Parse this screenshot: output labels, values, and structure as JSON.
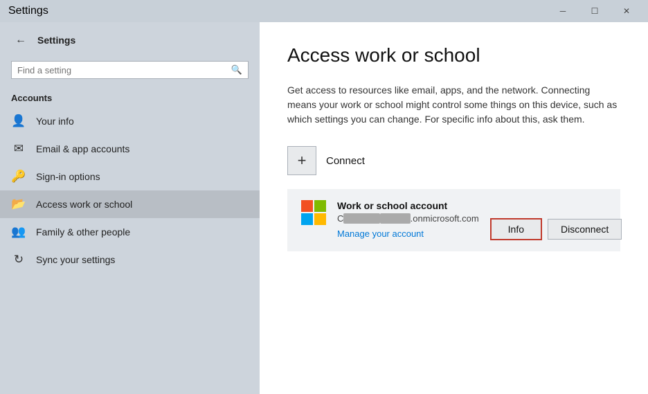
{
  "titlebar": {
    "title": "Settings",
    "min_label": "─",
    "max_label": "☐",
    "close_label": "✕"
  },
  "sidebar": {
    "back_icon": "←",
    "app_title": "Settings",
    "search": {
      "placeholder": "Find a setting",
      "icon": "⚲"
    },
    "section_label": "Accounts",
    "items": [
      {
        "label": "Your info",
        "icon": "👤",
        "active": false
      },
      {
        "label": "Email & app accounts",
        "icon": "✉",
        "active": false
      },
      {
        "label": "Sign-in options",
        "icon": "🔑",
        "active": false
      },
      {
        "label": "Access work or school",
        "icon": "🗂",
        "active": true
      },
      {
        "label": "Family & other people",
        "icon": "👥",
        "active": false
      },
      {
        "label": "Sync your settings",
        "icon": "🔄",
        "active": false
      }
    ]
  },
  "content": {
    "page_title": "Access work or school",
    "description": "Get access to resources like email, apps, and the network. Connecting means your work or school might control some things on this device, such as which settings you can change. For specific info about this, ask them.",
    "connect_label": "Connect",
    "connect_plus": "+",
    "account": {
      "type": "Work or school account",
      "email_prefix": "C",
      "email_redacted": "██████████e@",
      "email_domain_redacted": "████████████",
      "email_suffix": ".onmicrosoft.com",
      "manage_link": "Manage your account",
      "info_btn": "Info",
      "disconnect_btn": "Disconnect"
    },
    "ms_logo": {
      "colors": [
        "#f25022",
        "#7fba00",
        "#00a4ef",
        "#ffb900"
      ]
    }
  }
}
